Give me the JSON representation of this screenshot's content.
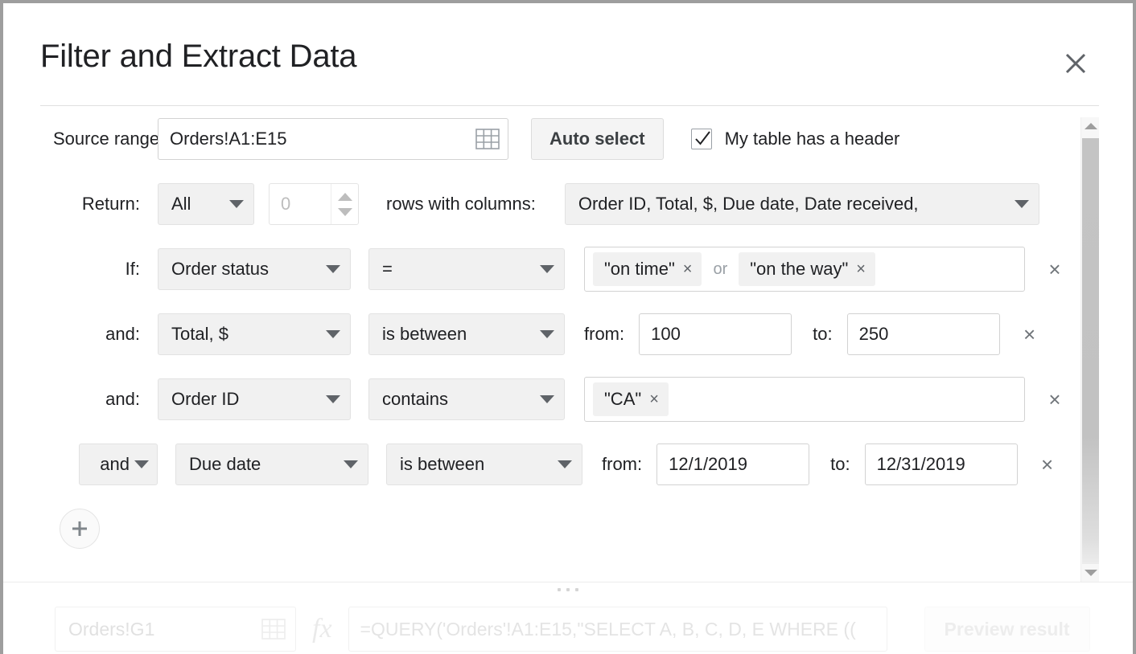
{
  "dialog": {
    "title": "Filter and Extract Data",
    "close_icon": "close-icon"
  },
  "source": {
    "label": "Source range:",
    "value": "Orders!A1:E15",
    "placeholder": "Orders!A1:E15",
    "picker_icon": "grid-range-picker-icon",
    "auto_select_label": "Auto select",
    "header_checkbox_label": "My table has a header",
    "header_checkbox_checked": true
  },
  "return": {
    "label": "Return:",
    "mode": "All",
    "count_value": "",
    "count_placeholder": "0",
    "rows_label": "rows with columns:",
    "columns": "Order ID, Total, $, Due date, Date received,"
  },
  "conditions": [
    {
      "conjunction": "If:",
      "conjunction_is_select": false,
      "field": "Order status",
      "operator": "=",
      "value_type": "chips",
      "chips": [
        "\"on time\"",
        "\"on the way\""
      ],
      "chip_join": "or",
      "remove_label": "×"
    },
    {
      "conjunction": "and:",
      "conjunction_is_select": false,
      "field": "Total, $",
      "operator": "is between",
      "value_type": "range",
      "from_label": "from:",
      "from_value": "100",
      "to_label": "to:",
      "to_value": "250",
      "remove_label": "×"
    },
    {
      "conjunction": "and:",
      "conjunction_is_select": false,
      "field": "Order ID",
      "operator": "contains",
      "value_type": "chips",
      "chips": [
        "\"CA\""
      ],
      "chip_join": "",
      "remove_label": "×"
    },
    {
      "conjunction": "and",
      "conjunction_is_select": true,
      "field": "Due date",
      "operator": "is between",
      "value_type": "range",
      "from_label": "from:",
      "from_value": "12/1/2019",
      "to_label": "to:",
      "to_value": "12/31/2019",
      "remove_label": "×"
    }
  ],
  "add_condition": {
    "icon": "plus-icon"
  },
  "scrollbar": {
    "up_icon": "scroll-up-arrow-icon",
    "down_icon": "scroll-down-arrow-icon"
  },
  "footer": {
    "destination_value": "Orders!G1",
    "destination_picker_icon": "grid-range-picker-icon",
    "fx_icon": "fx",
    "formula": "=QUERY('Orders'!A1:E15,\"SELECT A, B, C, D, E WHERE ((",
    "preview_label": "Preview result"
  },
  "colors": {
    "page_background": "#9e9e9e",
    "dialog_background": "#ffffff",
    "text": "#202124",
    "muted_text": "#9aa0a6",
    "control_background": "#f1f1f1",
    "border": "#d2d2d2"
  }
}
